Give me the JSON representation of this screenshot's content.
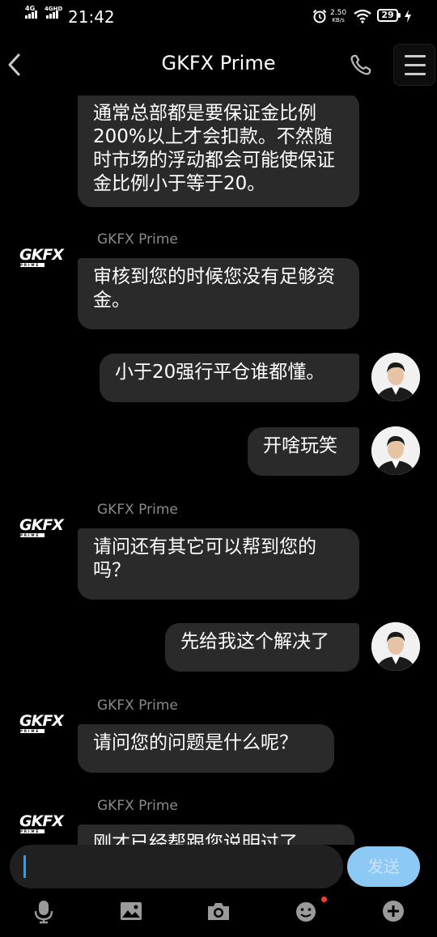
{
  "status_bar": {
    "signal1": "4G",
    "signal2": "4GHD",
    "time": "21:42",
    "speed_value": "2.50",
    "speed_unit": "KB/s",
    "battery": "29"
  },
  "header": {
    "title": "GKFX Prime"
  },
  "messages": [
    {
      "side": "left",
      "text": "通常总部都是要保证金比例200%以上才会扣款。不然随时市场的浮动都会可能使保证金比例小于等于20。"
    },
    {
      "side": "left",
      "sender": "GKFX Prime",
      "text": "审核到您的时候您没有足够资金。"
    },
    {
      "side": "right",
      "text": "小于20强行平仓谁都懂。"
    },
    {
      "side": "right",
      "text": "开啥玩笑"
    },
    {
      "side": "left",
      "sender": "GKFX Prime",
      "text": "请问还有其它可以帮到您的吗？"
    },
    {
      "side": "right",
      "text": "先给我这个解决了"
    },
    {
      "side": "left",
      "sender": "GKFX Prime",
      "text": "请问您的问题是什么呢？"
    },
    {
      "side": "left",
      "sender": "GKFX Prime",
      "text": "刚才已经帮跟您说明过了"
    }
  ],
  "logo": {
    "text": "GKFX",
    "sub": "PRIME"
  },
  "input": {
    "send_label": "发送"
  },
  "colors": {
    "background": "#000000",
    "bubble": "#2a2a2a",
    "send_button": "#8cc9f5",
    "caret": "#1aa3ff",
    "badge": "#ff3b30"
  },
  "toolbar": {
    "icons": [
      "microphone-icon",
      "image-icon",
      "camera-icon",
      "emoji-icon",
      "plus-icon"
    ]
  }
}
